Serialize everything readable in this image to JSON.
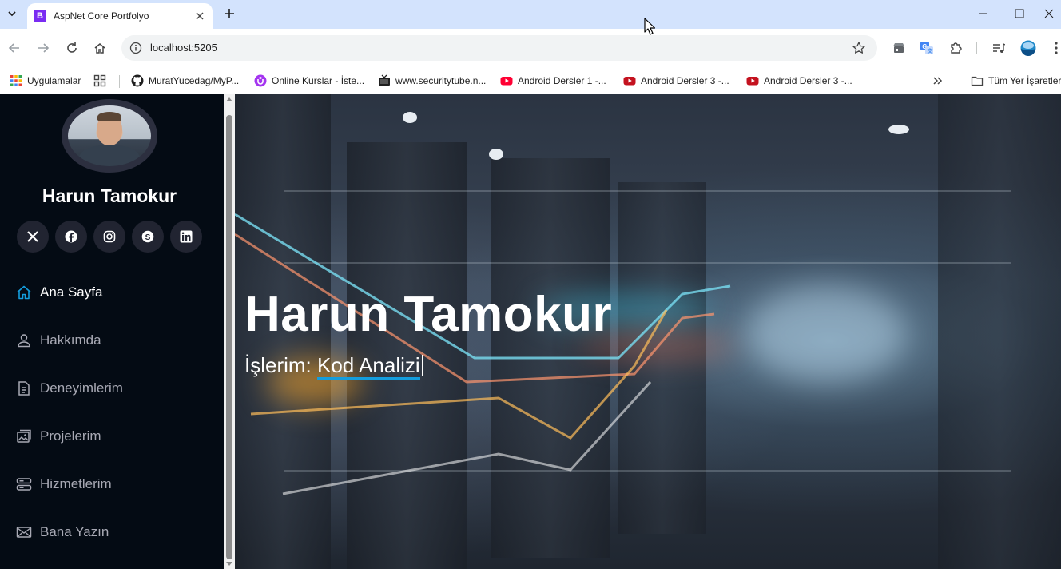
{
  "browser": {
    "tab_title": "AspNet Core Portfolyo",
    "favicon_letter": "B",
    "url": "localhost:5205"
  },
  "bookmarks": {
    "apps_label": "Uygulamalar",
    "items": [
      {
        "label": "MuratYucedag/MyP...",
        "icon": "github-icon"
      },
      {
        "label": "Online Kurslar - İste...",
        "icon": "udemy-icon"
      },
      {
        "label": "www.securitytube.n...",
        "icon": "tv-icon"
      },
      {
        "label": "Android Dersler 1 -...",
        "icon": "youtube-icon"
      },
      {
        "label": "Android Dersler 3 -...",
        "icon": "youtube-icon"
      },
      {
        "label": "Android Dersler 3 -...",
        "icon": "youtube-icon"
      }
    ],
    "all_bookmarks_label": "Tüm Yer İşaretleri"
  },
  "sidebar": {
    "name": "Harun Tamokur",
    "social": [
      {
        "icon": "x-icon"
      },
      {
        "icon": "facebook-icon"
      },
      {
        "icon": "instagram-icon"
      },
      {
        "icon": "skype-icon"
      },
      {
        "icon": "linkedin-icon"
      }
    ],
    "nav": [
      {
        "label": "Ana Sayfa",
        "icon": "home-icon",
        "active": true
      },
      {
        "label": "Hakkımda",
        "icon": "person-icon",
        "active": false
      },
      {
        "label": "Deneyimlerim",
        "icon": "document-icon",
        "active": false
      },
      {
        "label": "Projelerim",
        "icon": "images-icon",
        "active": false
      },
      {
        "label": "Hizmetlerim",
        "icon": "server-icon",
        "active": false
      },
      {
        "label": "Bana Yazın",
        "icon": "envelope-icon",
        "active": false
      }
    ]
  },
  "hero": {
    "title": "Harun Tamokur",
    "subtitle_prefix": "İşlerim: ",
    "typed_text": "Kod Analizi"
  },
  "colors": {
    "accent": "#149ddd",
    "sidebar_bg": "#040b14",
    "nav_text": "#a8a9b4"
  }
}
